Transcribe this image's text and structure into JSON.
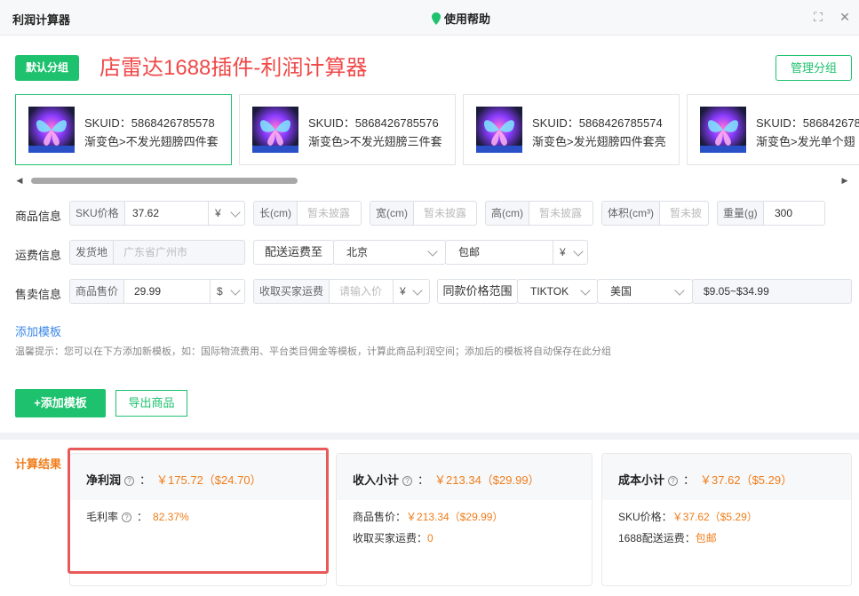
{
  "window": {
    "title": "利润计算器",
    "help_label": "使用帮助"
  },
  "header": {
    "group_button": "默认分组",
    "headline": "店雷达1688插件-利润计算器",
    "manage_button": "管理分组"
  },
  "sku_cards": [
    {
      "id_label": "SKUID：",
      "id": "5868426785578",
      "name": "渐变色>不发光翅膀四件套",
      "active": true
    },
    {
      "id_label": "SKUID：",
      "id": "5868426785576",
      "name": "渐变色>不发光翅膀三件套",
      "active": false
    },
    {
      "id_label": "SKUID：",
      "id": "5868426785574",
      "name": "渐变色>发光翅膀四件套亮",
      "active": false
    },
    {
      "id_label": "SKUID：",
      "id": "586842678",
      "name": "渐变色>发光单个翅",
      "active": false
    }
  ],
  "product_info": {
    "label": "商品信息",
    "sku_price": {
      "prefix": "SKU价格",
      "value": "37.62",
      "currency": "¥"
    },
    "length": {
      "prefix": "长(cm)",
      "placeholder": "暂未披露"
    },
    "width": {
      "prefix": "宽(cm)",
      "placeholder": "暂未披露"
    },
    "height": {
      "prefix": "高(cm)",
      "placeholder": "暂未披露"
    },
    "volume": {
      "prefix": "体积(cm³)",
      "placeholder": "暂未披"
    },
    "weight": {
      "prefix": "重量(g)",
      "value": "300"
    }
  },
  "shipping_info": {
    "label": "运费信息",
    "origin": {
      "prefix": "发货地",
      "value": "广东省广州市"
    },
    "destination_button": "配送运费至",
    "destination": "北京",
    "shipping_type": "包邮",
    "currency": "¥"
  },
  "sale_info": {
    "label": "售卖信息",
    "sale_price": {
      "prefix": "商品售价",
      "value": "29.99",
      "currency": "$"
    },
    "buyer_shipping": {
      "prefix": "收取买家运费",
      "placeholder": "请输入价",
      "currency": "¥"
    },
    "range_button": "同款价格范围",
    "platform": "TIKTOK",
    "country": "美国",
    "range": "$9.05~$34.99"
  },
  "templates": {
    "add_link": "添加模板",
    "tip": "温馨提示：您可以在下方添加新模板，如：国际物流费用、平台类目佣金等模板，计算此商品利润空间；添加后的模板将自动保存在此分组",
    "add_button": "+添加模板",
    "export_button": "导出商品"
  },
  "results": {
    "label": "计算结果",
    "net_profit": {
      "title": "净利润",
      "value": "￥175.72（$24.70）",
      "margin_label": "毛利率",
      "margin_value": "82.37%"
    },
    "income": {
      "title": "收入小计",
      "value": "￥213.34（$29.99）",
      "price_label": "商品售价：",
      "price_value": "￥213.34（$29.99）",
      "shipping_label": "收取买家运费：",
      "shipping_value": "0"
    },
    "cost": {
      "title": "成本小计",
      "value": "￥37.62（$5.29）",
      "sku_label": "SKU价格：",
      "sku_value": "￥37.62（$5.29）",
      "ship_label": "1688配送运费：",
      "ship_value": "包邮"
    }
  },
  "colors": {
    "accent": "#1ec16e",
    "highlight": "#e85a5a",
    "orange": "#f07d1a",
    "link": "#3a86e6"
  }
}
